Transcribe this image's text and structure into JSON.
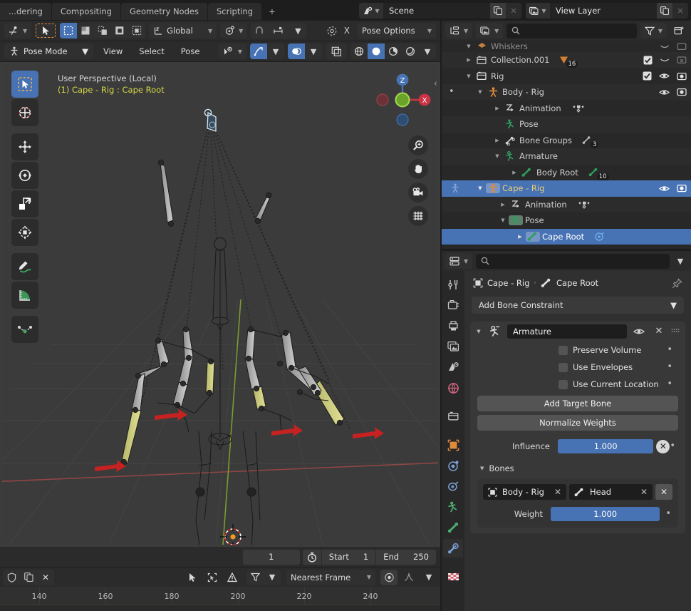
{
  "topbar": {
    "workspace_tabs": [
      {
        "label": "...dering",
        "active": false
      },
      {
        "label": "Compositing",
        "active": false
      },
      {
        "label": "Geometry Nodes",
        "active": false
      },
      {
        "label": "Scripting",
        "active": false
      },
      {
        "label": "+",
        "active": false
      }
    ],
    "scene": {
      "icon": "scene-icon",
      "name": "Scene",
      "copy_icon": "duplicate-icon",
      "close_icon": "x-icon"
    },
    "view_layer": {
      "icon": "view-layer-icon",
      "name": "View Layer",
      "copy_icon": "duplicate-icon",
      "close_icon": "x-icon"
    }
  },
  "viewport_header_row1": {
    "editor_type_icon": "editor-type-icon",
    "tweak_icon": "tweak-tool-icon",
    "select_modes": [
      "select-new-icon",
      "select-extend-icon",
      "select-subtract-icon",
      "select-invert-icon",
      "select-intersect-icon"
    ],
    "transform_orientation": "Global",
    "pivot_icon": "pivot-point-icon",
    "snap_magnet_icon": "snap-magnet-icon",
    "snap_to_icon": "snap-increment-icon",
    "proportional_icon": "proportional-edit-icon",
    "proportional_off_label": "X",
    "pose_options": "Pose Options"
  },
  "viewport_header_row2": {
    "mode": "Pose Mode",
    "mode_icon": "pose-mode-icon",
    "menus": [
      "View",
      "Select",
      "Pose"
    ],
    "visibility_icon": "object-visibility-icon",
    "gizmo_icon": "gizmo-icon",
    "overlays_icon": "overlays-icon",
    "xray_icon": "xray-icon",
    "shading_modes": [
      "wireframe-shading-icon",
      "solid-shading-icon",
      "material-shading-icon",
      "rendered-shading-icon"
    ],
    "shading_active_index": 1
  },
  "viewport": {
    "perspective_label": "User Perspective (Local)",
    "object_label": "(1) Cape - Rig : Cape Root",
    "background_color": "#3b3b3b",
    "tools": [
      {
        "name": "tweak-select-box-tool",
        "label": "Select Box",
        "active": true
      },
      {
        "name": "cursor-tool",
        "label": "Cursor",
        "active": false
      },
      {
        "name": "move-tool",
        "label": "Move",
        "active": false
      },
      {
        "name": "rotate-tool",
        "label": "Rotate",
        "active": false
      },
      {
        "name": "scale-tool",
        "label": "Scale",
        "active": false
      },
      {
        "name": "transform-tool",
        "label": "Transform",
        "active": false
      },
      {
        "name": "annotate-tool",
        "label": "Annotate",
        "active": false
      },
      {
        "name": "measure-tool",
        "label": "Measure",
        "active": false
      },
      {
        "name": "bendy-bone-tool",
        "label": "Bendy Bone",
        "active": false
      }
    ],
    "gizmo_axes": [
      {
        "label": "Z",
        "color": "#4772b3"
      },
      {
        "label": "X",
        "color": "#cc3344"
      },
      {
        "label": "",
        "color": "#7ac943"
      }
    ],
    "nav_buttons": [
      "zoom-icon",
      "pan-icon",
      "camera-icon",
      "grid-ortho-icon"
    ],
    "cursor_color": "#ee9922",
    "axis_x_color": "#9c4a4a",
    "axis_y_color": "#7ca030",
    "bone_fill": "#c8c8c8",
    "bone_selected_fill": "#d6d68a",
    "custom_shape_color": "#cc2222"
  },
  "timeline": {
    "current_frame": "1",
    "timer_icon": "timer-icon",
    "start_label": "Start",
    "start_value": "1",
    "end_label": "End",
    "end_value": "250"
  },
  "dopesheet": {
    "left_icons": [
      "shield-icon",
      "copy-icon",
      "x-icon"
    ],
    "right_icons": [
      "cursor-arrow-icon",
      "select-bounds-icon",
      "warning-icon",
      "filter-icon"
    ],
    "snap_mode": "Nearest Frame",
    "proportional_icon": "proportional-edit-icon",
    "falloff_icon": "falloff-curve-icon",
    "ruler_ticks": [
      "140",
      "160",
      "180",
      "200",
      "220",
      "240"
    ]
  },
  "outliner": {
    "display_mode_icon": "outliner-display-mode-icon",
    "filter_id_icon": "filter-id-icon",
    "search_placeholder": "",
    "search_icon": "search-icon",
    "filter_icon": "funnel-icon",
    "new_collection_icon": "new-collection-icon",
    "rows": [
      {
        "indent": 1,
        "tri": "down",
        "icon": "collection-icon",
        "label": "Whiskers",
        "truncated": true,
        "badge": "",
        "checkbox": false,
        "eye": true,
        "camera": true,
        "selected": false,
        "partial": true
      },
      {
        "indent": 1,
        "tri": "right",
        "icon": "collection-icon",
        "label": "Collection.001",
        "badge": "16",
        "badge_icon": "mesh-data-icon",
        "checkbox": true,
        "eye": "closed",
        "camera": "disabled",
        "selected": false
      },
      {
        "indent": 1,
        "tri": "down",
        "icon": "collection-icon",
        "label": "Rig",
        "badge": "",
        "checkbox": true,
        "eye": true,
        "camera": true,
        "selected": false
      },
      {
        "indent": 2,
        "tri": "down",
        "icon": "armature-object-icon",
        "label": "Body - Rig",
        "badge": "",
        "checkbox": false,
        "eye": true,
        "camera": true,
        "selected": false,
        "dot": true
      },
      {
        "indent": 3,
        "tri": "right",
        "icon": "animation-icon",
        "label": "Animation",
        "badge": "keyframe-icon",
        "selected": false
      },
      {
        "indent": 3,
        "tri": "none",
        "icon": "pose-icon",
        "label": "Pose",
        "selected": false
      },
      {
        "indent": 3,
        "tri": "right",
        "icon": "bone-group-icon",
        "label": "Bone Groups",
        "badge": "3",
        "badge_icon": "bone-group-icon",
        "selected": false
      },
      {
        "indent": 3,
        "tri": "down",
        "icon": "armature-data-icon",
        "label": "Armature",
        "selected": false
      },
      {
        "indent": 4,
        "tri": "right",
        "icon": "bone-icon",
        "label": "Body Root",
        "badge": "10",
        "badge_icon": "bone-icon",
        "selected": false
      },
      {
        "indent": 2,
        "tri": "down",
        "icon": "armature-object-icon",
        "label": "Cape - Rig",
        "eye": true,
        "camera": true,
        "selected": true,
        "active": true
      },
      {
        "indent": 3,
        "tri": "right",
        "icon": "animation-icon",
        "label": "Animation",
        "badge": "keyframe-icon",
        "selected": false
      },
      {
        "indent": 3,
        "tri": "down",
        "icon": "pose-icon",
        "label": "Pose",
        "selected": false,
        "highlight_icon": true
      },
      {
        "indent": 4,
        "tri": "right",
        "icon": "bone-icon",
        "label": "Cape Root",
        "badge": "constraint-icon",
        "selected": true,
        "highlight_icon": true
      }
    ]
  },
  "properties": {
    "editor_icon": "properties-editor-icon",
    "search_placeholder": "",
    "search_icon": "search-icon",
    "dropdown_icon": "chevron-down-icon",
    "tabs": [
      {
        "name": "tool-tab",
        "icon": "tool-icon",
        "color": "#c8c8c8",
        "active": false
      },
      {
        "name": "render-tab",
        "icon": "render-camera-icon",
        "color": "#c8c8c8",
        "active": false
      },
      {
        "name": "output-tab",
        "icon": "printer-icon",
        "color": "#c8c8c8",
        "active": false
      },
      {
        "name": "view-layer-tab",
        "icon": "images-icon",
        "color": "#c8c8c8",
        "active": false
      },
      {
        "name": "scene-tab",
        "icon": "scene-cone-icon",
        "color": "#c8c8c8",
        "active": false
      },
      {
        "name": "world-tab",
        "icon": "world-globe-icon",
        "color": "#d4677f",
        "active": false
      },
      {
        "name": "collection-tab",
        "icon": "collection-box-icon",
        "color": "#c8c8c8",
        "active": false
      },
      {
        "name": "object-tab",
        "icon": "object-square-icon",
        "color": "#e08a3c",
        "active": false
      },
      {
        "name": "modifier-tab",
        "icon": "physics-orbit-icon",
        "color": "#7c9fd6",
        "active": false
      },
      {
        "name": "object-constraint-tab",
        "icon": "constraint-icon",
        "color": "#7c9fd6",
        "active": false
      },
      {
        "name": "armature-data-tab",
        "icon": "armature-running-icon",
        "color": "#4caf70",
        "active": false
      },
      {
        "name": "bone-tab",
        "icon": "bone-icon",
        "color": "#4caf70",
        "active": false
      },
      {
        "name": "bone-constraint-tab",
        "icon": "bone-constraint-icon",
        "color": "#7c9fd6",
        "active": true
      },
      {
        "name": "material-tab",
        "icon": "checker-material-icon",
        "color": "#cc5566",
        "active": false
      }
    ],
    "breadcrumb": {
      "object_icon": "object-square-icon",
      "object": "Cape - Rig",
      "separator": "›",
      "bone_icon": "bone-icon",
      "bone": "Cape Root",
      "pin_icon": "pin-icon"
    },
    "add_constraint": {
      "label": "Add Bone Constraint",
      "caret": "chevron-down-icon"
    },
    "constraint": {
      "expand_icon": "triangle-down-icon",
      "type_icon": "armature-constraint-icon",
      "name": "Armature",
      "visibility_icon": "eye-icon",
      "delete_icon": "x-icon",
      "grip_icon": "drag-grip-icon",
      "checkboxes": [
        {
          "label": "Preserve Volume",
          "checked": false
        },
        {
          "label": "Use Envelopes",
          "checked": false
        },
        {
          "label": "Use Current Location",
          "checked": false
        }
      ],
      "buttons": [
        "Add Target Bone",
        "Normalize Weights"
      ],
      "influence": {
        "label": "Influence",
        "value": "1.000",
        "reset_icon": "x-circle-icon"
      },
      "bones_section": {
        "label": "Bones",
        "expand_icon": "triangle-down-icon",
        "target": {
          "object_icon": "object-square-icon",
          "object": "Body - Rig",
          "object_clear_icon": "x-icon",
          "bone_icon": "bone-icon",
          "bone": "Head",
          "bone_clear_icon": "x-icon",
          "remove_icon": "x-icon"
        },
        "weight": {
          "label": "Weight",
          "value": "1.000"
        }
      }
    }
  },
  "colors": {
    "accent_blue": "#4772b3",
    "panel_bg": "#303030",
    "header_bg": "#2b2b2b",
    "outliner_bg": "#282828",
    "viewport_bg": "#3b3b3b",
    "text": "#e5e5e5"
  }
}
